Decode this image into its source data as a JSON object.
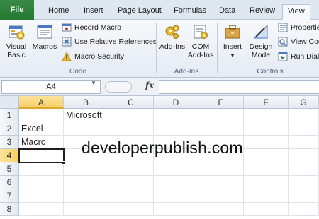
{
  "tabs": {
    "file": "File",
    "home": "Home",
    "insert": "Insert",
    "page_layout": "Page Layout",
    "formulas": "Formulas",
    "data": "Data",
    "review": "Review",
    "view": "View"
  },
  "ribbon": {
    "code": {
      "label": "Code",
      "visual_basic": "Visual Basic",
      "visual_basic_l1": "Visual",
      "visual_basic_l2": "Basic",
      "macros": "Macros",
      "record_macro": "Record Macro",
      "use_relative": "Use Relative References",
      "macro_security": "Macro Security"
    },
    "addins": {
      "label": "Add-Ins",
      "addins": "Add-Ins",
      "com_l1": "COM",
      "com_l2": "Add-Ins"
    },
    "controls": {
      "label": "Controls",
      "insert": "Insert",
      "design_l1": "Design",
      "design_l2": "Mode",
      "properties": "Properties",
      "view_code": "View Code",
      "run_dialog": "Run Dialog"
    }
  },
  "formula_bar": {
    "name_box": "A4",
    "fx": "fx",
    "value": ""
  },
  "grid": {
    "columns": [
      "A",
      "B",
      "C",
      "D",
      "E",
      "F",
      "G"
    ],
    "rows": [
      "1",
      "2",
      "3",
      "4",
      "5",
      "6",
      "7",
      "8"
    ],
    "cells": {
      "B1": "Microsoft",
      "A2": "Excel",
      "A3": "Macro"
    },
    "selected_cell": "A4"
  },
  "watermark": "developerpublish.com",
  "colors": {
    "file_tab": "#2f8a3e",
    "selection_header": "#f8cf68",
    "ribbon_bg": "#eef2f8"
  }
}
